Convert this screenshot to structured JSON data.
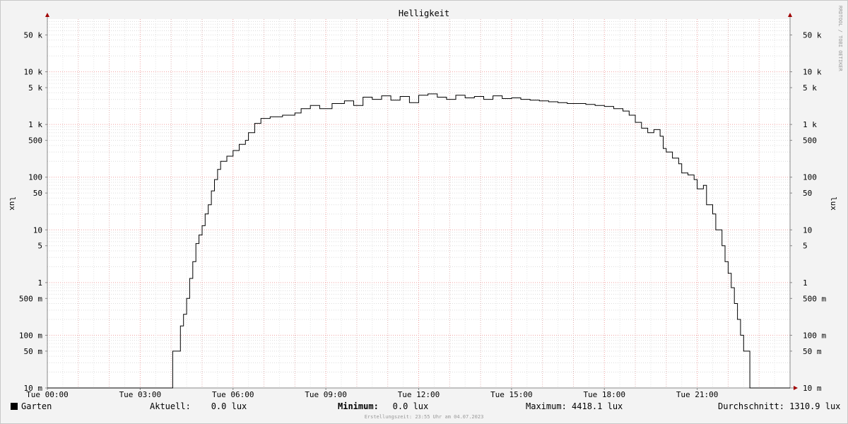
{
  "chart_data": {
    "type": "line",
    "title": "Helligkeit",
    "ylabel": "lux",
    "ylabel_right": "lux",
    "watermark": "RRDTOOL / TOBI OETIKER",
    "yscale": "log",
    "ylim": [
      0.01,
      100000
    ],
    "xlim": [
      0,
      24
    ],
    "x_ticks": [
      {
        "x": 0,
        "label": "Tue 00:00"
      },
      {
        "x": 3,
        "label": "Tue 03:00"
      },
      {
        "x": 6,
        "label": "Tue 06:00"
      },
      {
        "x": 9,
        "label": "Tue 09:00"
      },
      {
        "x": 12,
        "label": "Tue 12:00"
      },
      {
        "x": 15,
        "label": "Tue 15:00"
      },
      {
        "x": 18,
        "label": "Tue 18:00"
      },
      {
        "x": 21,
        "label": "Tue 21:00"
      }
    ],
    "y_ticks": [
      {
        "v": 50000,
        "label": "50 k"
      },
      {
        "v": 10000,
        "label": "10 k"
      },
      {
        "v": 5000,
        "label": "5 k"
      },
      {
        "v": 1000,
        "label": "1 k"
      },
      {
        "v": 500,
        "label": "500"
      },
      {
        "v": 100,
        "label": "100"
      },
      {
        "v": 50,
        "label": "50"
      },
      {
        "v": 10,
        "label": "10"
      },
      {
        "v": 5,
        "label": "5"
      },
      {
        "v": 1,
        "label": "1"
      },
      {
        "v": 0.5,
        "label": "500 m"
      },
      {
        "v": 0.1,
        "label": "100 m"
      },
      {
        "v": 0.05,
        "label": "50 m"
      },
      {
        "v": 0.01,
        "label": "10 m"
      }
    ],
    "series": [
      {
        "name": "Garten",
        "color": "#000000",
        "points": [
          [
            0.0,
            0.01
          ],
          [
            4.05,
            0.01
          ],
          [
            4.05,
            0.05
          ],
          [
            4.25,
            0.05
          ],
          [
            4.3,
            0.15
          ],
          [
            4.4,
            0.25
          ],
          [
            4.5,
            0.5
          ],
          [
            4.6,
            1.2
          ],
          [
            4.7,
            2.5
          ],
          [
            4.8,
            5.5
          ],
          [
            4.9,
            8
          ],
          [
            5.0,
            12
          ],
          [
            5.1,
            20
          ],
          [
            5.2,
            30
          ],
          [
            5.3,
            55
          ],
          [
            5.4,
            90
          ],
          [
            5.5,
            140
          ],
          [
            5.6,
            200
          ],
          [
            5.8,
            250
          ],
          [
            6.0,
            320
          ],
          [
            6.2,
            420
          ],
          [
            6.4,
            500
          ],
          [
            6.5,
            700
          ],
          [
            6.7,
            1050
          ],
          [
            6.9,
            1300
          ],
          [
            7.2,
            1400
          ],
          [
            7.6,
            1500
          ],
          [
            8.0,
            1650
          ],
          [
            8.2,
            2000
          ],
          [
            8.5,
            2300
          ],
          [
            8.8,
            2000
          ],
          [
            9.2,
            2500
          ],
          [
            9.6,
            2800
          ],
          [
            9.9,
            2300
          ],
          [
            10.2,
            3300
          ],
          [
            10.5,
            3000
          ],
          [
            10.8,
            3500
          ],
          [
            11.1,
            2900
          ],
          [
            11.4,
            3400
          ],
          [
            11.7,
            2600
          ],
          [
            12.0,
            3600
          ],
          [
            12.3,
            3800
          ],
          [
            12.6,
            3300
          ],
          [
            12.9,
            3000
          ],
          [
            13.2,
            3600
          ],
          [
            13.5,
            3200
          ],
          [
            13.8,
            3400
          ],
          [
            14.1,
            3000
          ],
          [
            14.4,
            3500
          ],
          [
            14.7,
            3100
          ],
          [
            15.0,
            3200
          ],
          [
            15.3,
            3000
          ],
          [
            15.6,
            2900
          ],
          [
            15.9,
            2800
          ],
          [
            16.2,
            2700
          ],
          [
            16.5,
            2600
          ],
          [
            16.8,
            2500
          ],
          [
            17.1,
            2500
          ],
          [
            17.4,
            2400
          ],
          [
            17.7,
            2300
          ],
          [
            18.0,
            2200
          ],
          [
            18.3,
            2000
          ],
          [
            18.6,
            1800
          ],
          [
            18.8,
            1500
          ],
          [
            19.0,
            1100
          ],
          [
            19.2,
            850
          ],
          [
            19.4,
            700
          ],
          [
            19.6,
            800
          ],
          [
            19.8,
            600
          ],
          [
            19.9,
            350
          ],
          [
            20.0,
            300
          ],
          [
            20.2,
            230
          ],
          [
            20.4,
            180
          ],
          [
            20.5,
            120
          ],
          [
            20.7,
            110
          ],
          [
            20.9,
            90
          ],
          [
            21.0,
            60
          ],
          [
            21.2,
            70
          ],
          [
            21.3,
            30
          ],
          [
            21.5,
            20
          ],
          [
            21.6,
            10
          ],
          [
            21.8,
            5
          ],
          [
            21.9,
            2.5
          ],
          [
            22.0,
            1.5
          ],
          [
            22.1,
            0.8
          ],
          [
            22.2,
            0.4
          ],
          [
            22.3,
            0.2
          ],
          [
            22.4,
            0.1
          ],
          [
            22.5,
            0.05
          ],
          [
            22.6,
            0.05
          ],
          [
            22.7,
            0.01
          ],
          [
            24.0,
            0.01
          ]
        ]
      }
    ]
  },
  "legend": {
    "series_label": "Garten",
    "current": "Aktuell:    0.0 lux",
    "minimum_label": "Minimum:",
    "minimum_value": "   0.0 lux",
    "maximum": "Maximum: 4418.1 lux",
    "average": "Durchschnitt: 1310.9 lux"
  },
  "footer": "Erstellungszeit: 23:55 Uhr am 04.07.2023"
}
